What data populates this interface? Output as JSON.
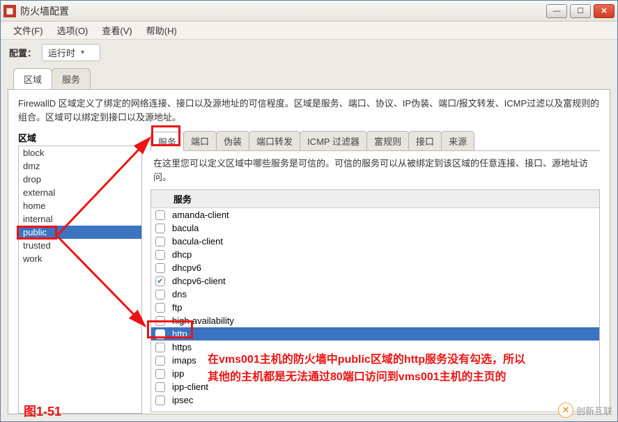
{
  "window": {
    "title": "防火墙配置"
  },
  "menubar": {
    "file": "文件(F)",
    "options": "选项(O)",
    "view": "查看(V)",
    "help": "帮助(H)"
  },
  "config": {
    "label": "配置：",
    "value": "运行时"
  },
  "topTabs": {
    "zone": "区域",
    "service": "服务"
  },
  "zonePanel": {
    "description": "FirewallD 区域定义了绑定的网络连接、接口以及源地址的可信程度。区域是服务、端口、协议、IP伪装、端口/报文转发、ICMP过滤以及富规则的组合。区域可以绑定到接口以及源地址。",
    "label": "区域",
    "items": [
      "block",
      "dmz",
      "drop",
      "external",
      "home",
      "internal",
      "public",
      "trusted",
      "work"
    ],
    "selectedIndex": 6
  },
  "subTabs": {
    "items": [
      "服务",
      "端口",
      "伪装",
      "端口转发",
      "ICMP 过滤器",
      "富规则",
      "接口",
      "来源"
    ],
    "activeIndex": 0
  },
  "servicesPanel": {
    "description": "在这里您可以定义区域中哪些服务是可信的。可信的服务可以从被绑定到该区域的任意连接、接口、源地址访问。",
    "header": "服务",
    "items": [
      {
        "label": "amanda-client",
        "checked": false
      },
      {
        "label": "bacula",
        "checked": false
      },
      {
        "label": "bacula-client",
        "checked": false
      },
      {
        "label": "dhcp",
        "checked": false
      },
      {
        "label": "dhcpv6",
        "checked": false
      },
      {
        "label": "dhcpv6-client",
        "checked": true
      },
      {
        "label": "dns",
        "checked": false
      },
      {
        "label": "ftp",
        "checked": false
      },
      {
        "label": "high-availability",
        "checked": false
      },
      {
        "label": "http",
        "checked": false
      },
      {
        "label": "https",
        "checked": false
      },
      {
        "label": "imaps",
        "checked": false
      },
      {
        "label": "ipp",
        "checked": false
      },
      {
        "label": "ipp-client",
        "checked": false
      },
      {
        "label": "ipsec",
        "checked": false
      }
    ],
    "selectedIndex": 9
  },
  "annotations": {
    "figLabel": "图1-51",
    "line1": "在vms001主机的防火墙中public区域的http服务没有勾选，所以",
    "line2": "其他的主机都是无法通过80端口访问到vms001主机的主页的",
    "watermark": "创新互联"
  },
  "colors": {
    "selection": "#3b74c0",
    "annotation": "#e11"
  }
}
